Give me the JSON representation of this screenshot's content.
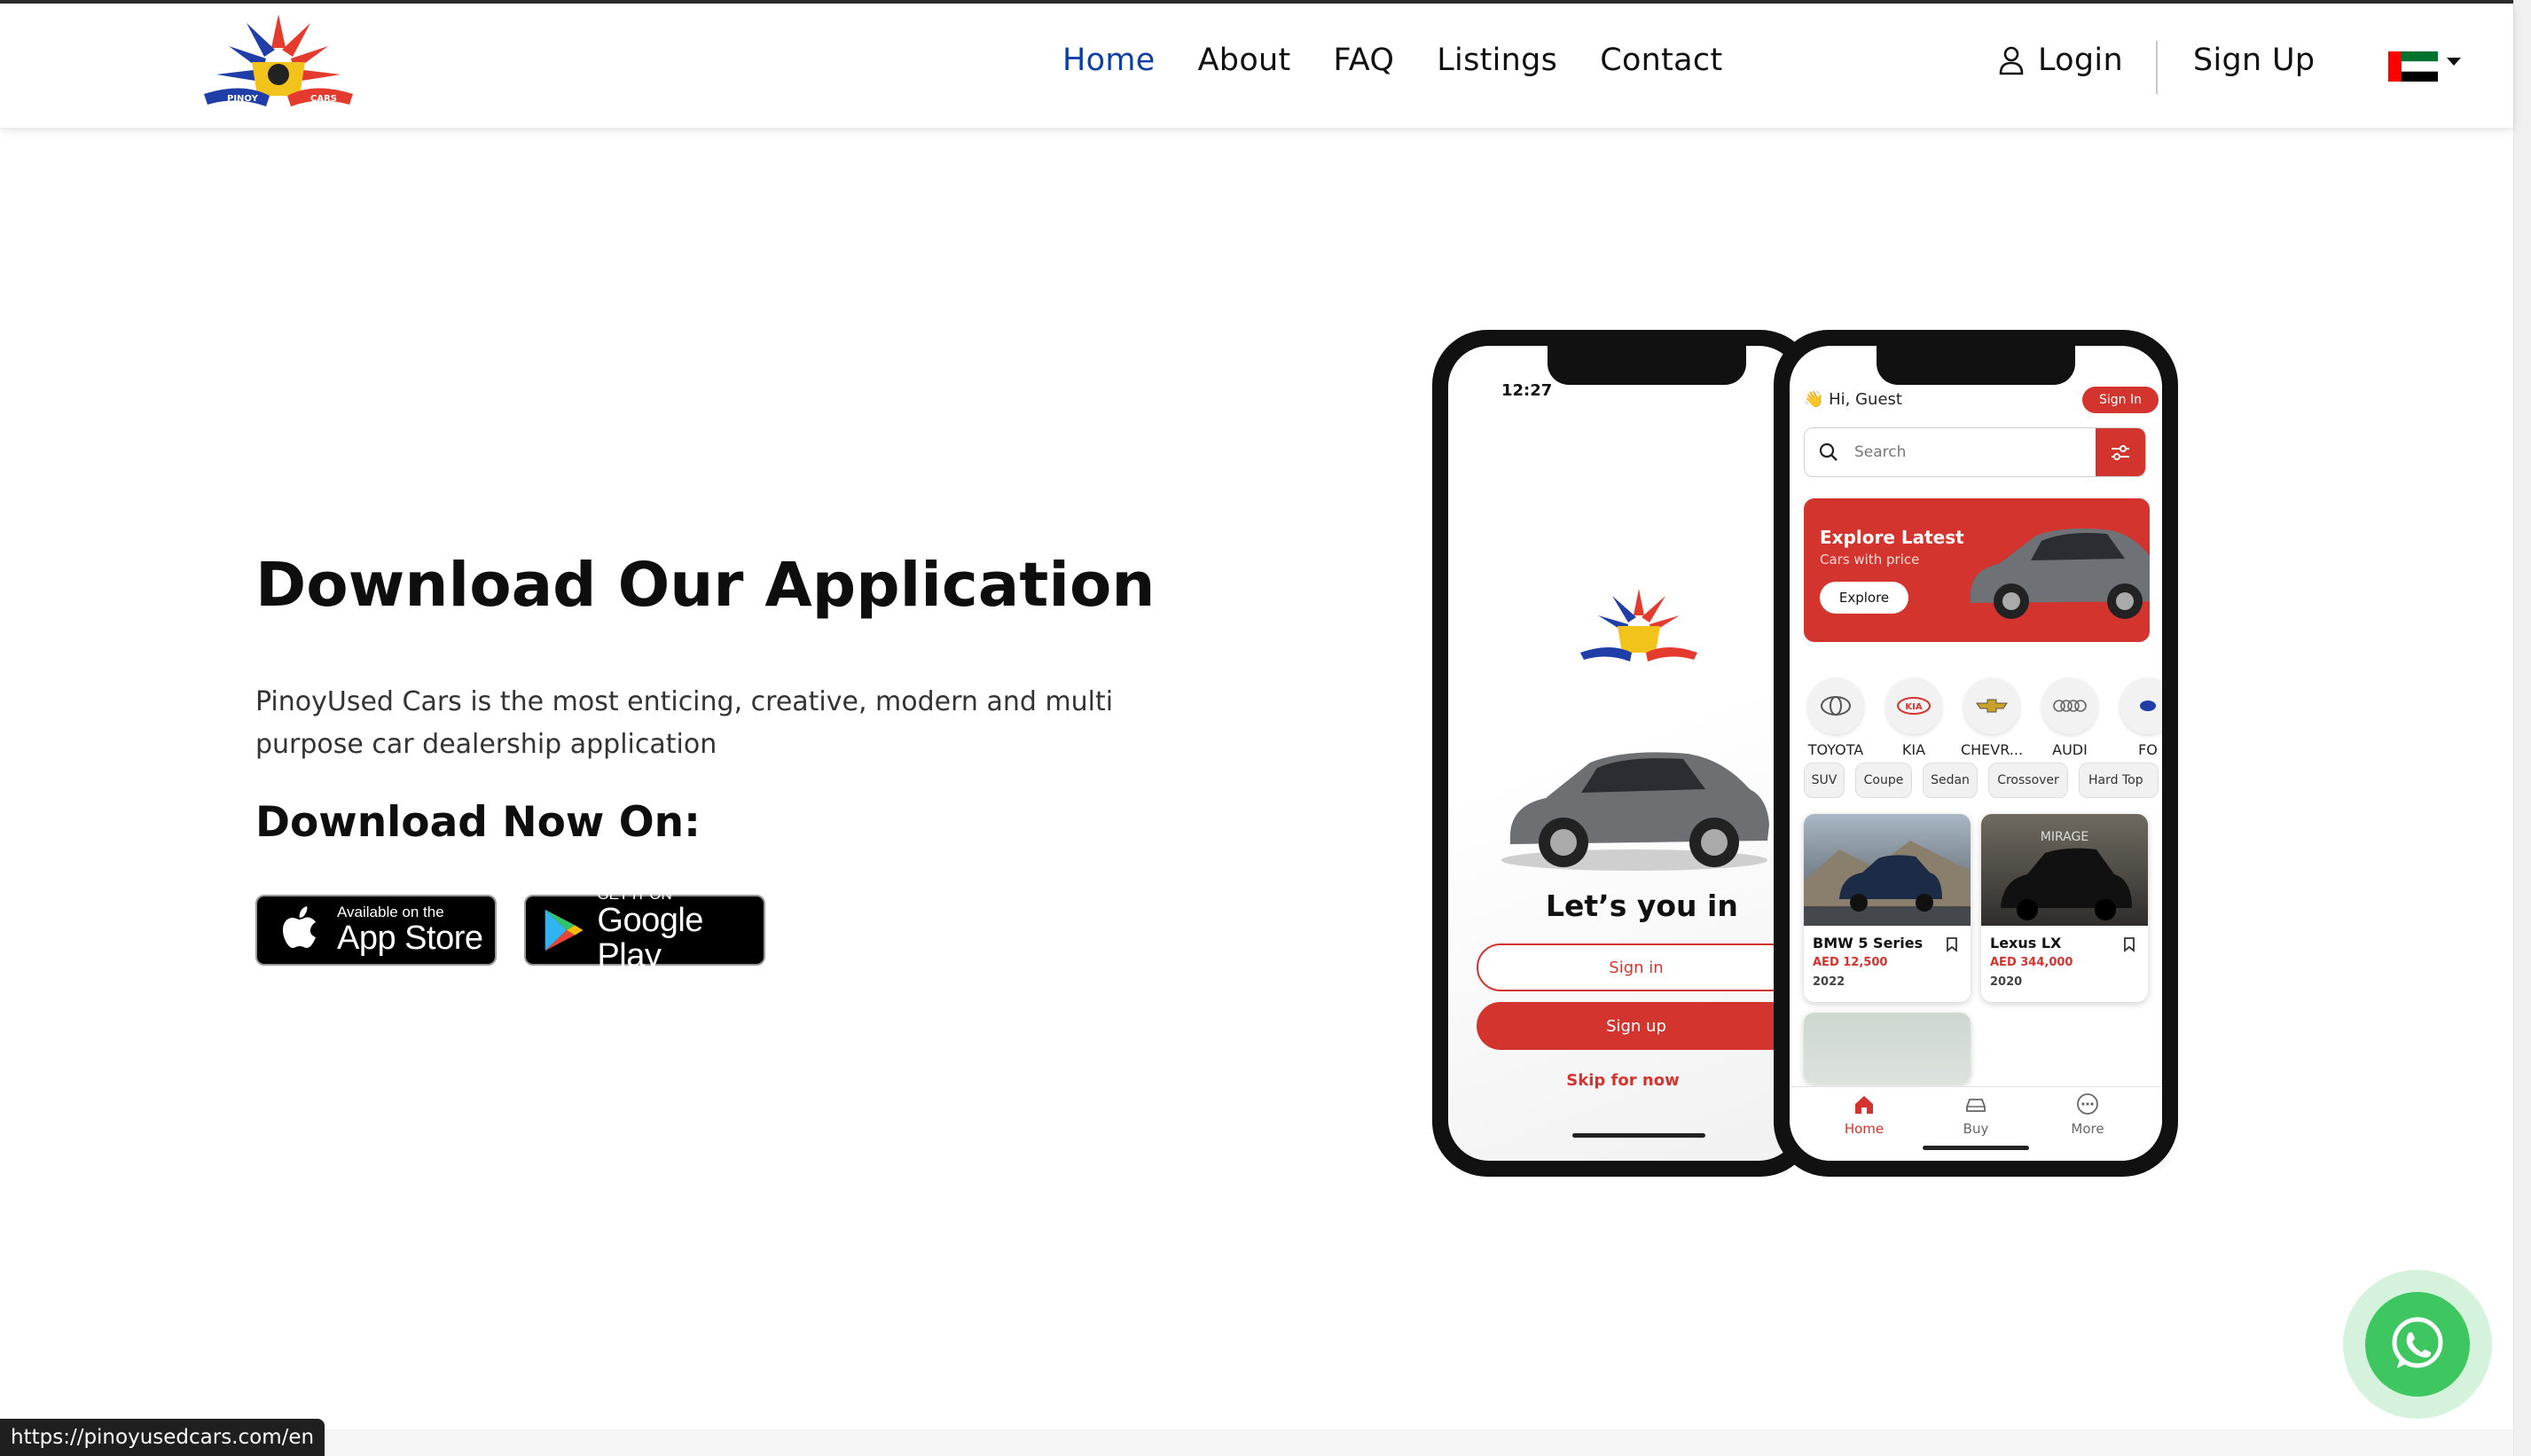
{
  "nav": {
    "links": [
      "Home",
      "About",
      "FAQ",
      "Listings",
      "Contact"
    ],
    "active": "Home",
    "login": "Login",
    "signup": "Sign Up"
  },
  "hero": {
    "title": "Download Our Application",
    "description": "PinoyUsed Cars is the most enticing, creative, modern and multi purpose car dealership application",
    "download_label": "Download Now On:",
    "appstore_small": "Available on the",
    "appstore_big": "App Store",
    "googleplay_small": "GET IT ON",
    "googleplay_big": "Google Play"
  },
  "phone_left": {
    "time": "12:27",
    "heading": "Let’s you in",
    "signin": "Sign in",
    "signup": "Sign up",
    "skip": "Skip for now"
  },
  "phone_right": {
    "greeting": "👋 Hi, Guest",
    "signin_pill": "Sign In",
    "search_placeholder": "Search",
    "banner_title": "Explore Latest",
    "banner_sub": "Cars with price",
    "banner_btn": "Explore",
    "brands": [
      "TOYOTA",
      "KIA",
      "CHEVR...",
      "AUDI",
      "FO"
    ],
    "types": [
      "SUV",
      "Coupe",
      "Sedan",
      "Crossover",
      "Hard Top"
    ],
    "cars": [
      {
        "name": "BMW 5 Series",
        "price": "AED 12,500",
        "year": "2022"
      },
      {
        "name": "Lexus LX",
        "price": "AED 344,000",
        "year": "2020"
      }
    ],
    "mirage_text": "MIRAGE",
    "tabs": [
      "Home",
      "Buy",
      "More"
    ]
  },
  "status_url": "https://pinoyusedcars.com/en",
  "colors": {
    "accent": "#d3342e",
    "nav_active": "#0d3fa6",
    "whatsapp": "#3ec760"
  }
}
